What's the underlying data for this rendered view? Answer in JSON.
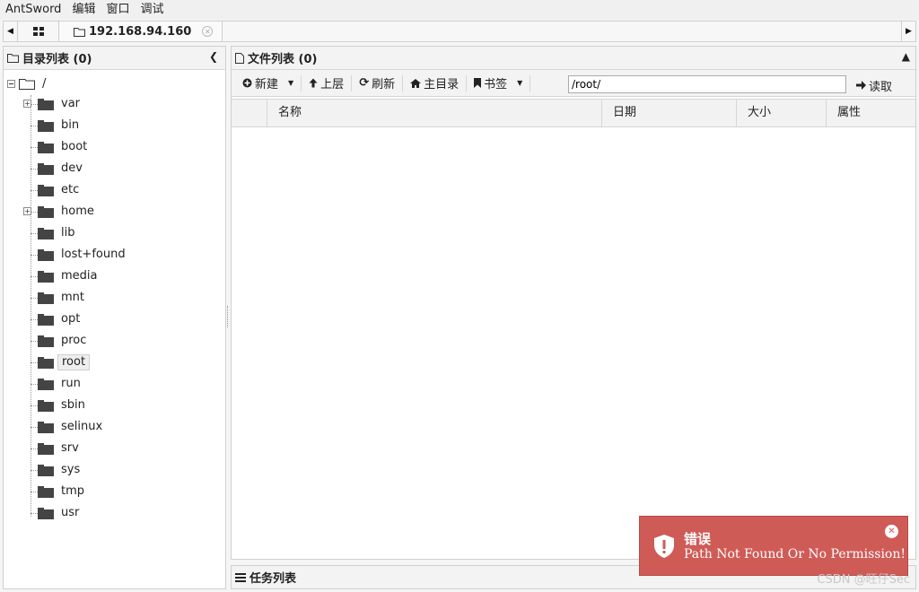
{
  "menubar": {
    "items": [
      "AntSword",
      "编辑",
      "窗口",
      "调试"
    ]
  },
  "tabs": {
    "active_label": "192.168.94.160"
  },
  "left_panel": {
    "title": "目录列表 (0)",
    "root_label": "/",
    "items": [
      {
        "label": "var",
        "expandable": true
      },
      {
        "label": "bin"
      },
      {
        "label": "boot"
      },
      {
        "label": "dev"
      },
      {
        "label": "etc"
      },
      {
        "label": "home",
        "expandable": true
      },
      {
        "label": "lib"
      },
      {
        "label": "lost+found"
      },
      {
        "label": "media"
      },
      {
        "label": "mnt"
      },
      {
        "label": "opt"
      },
      {
        "label": "proc"
      },
      {
        "label": "root",
        "selected": true
      },
      {
        "label": "run"
      },
      {
        "label": "sbin"
      },
      {
        "label": "selinux"
      },
      {
        "label": "srv"
      },
      {
        "label": "sys"
      },
      {
        "label": "tmp"
      },
      {
        "label": "usr"
      }
    ]
  },
  "right_panel": {
    "title": "文件列表 (0)",
    "toolbar": {
      "new_label": "新建",
      "up_label": "上层",
      "refresh_label": "刷新",
      "home_label": "主目录",
      "bookmark_label": "书签",
      "path_value": "/root/",
      "read_label": "读取"
    },
    "columns": [
      "名称",
      "日期",
      "大小",
      "属性"
    ]
  },
  "task_panel": {
    "title": "任务列表"
  },
  "toast": {
    "title": "错误",
    "message": "Path Not Found Or No Permission!",
    "background": "#cf5b57"
  },
  "watermark": "CSDN @旺仔Sec"
}
